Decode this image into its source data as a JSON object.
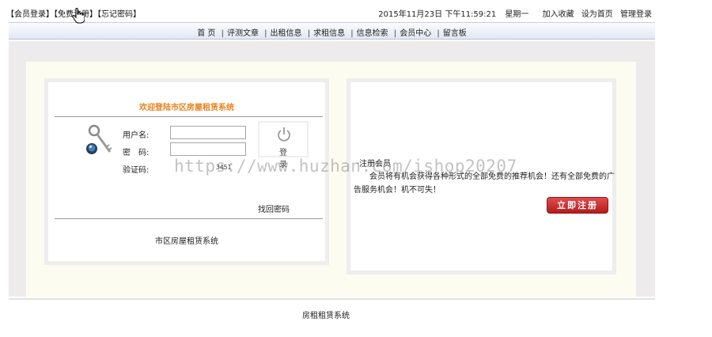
{
  "topbar": {
    "login_link": "【会员登录】",
    "register_link": "【免费注册】",
    "forgot_link": "【忘记密码】",
    "datetime": "2015年11月23日 下午11:59:21",
    "weekday": "星期一",
    "favorite_link": "加入收藏",
    "homepage_link": "设为首页",
    "admin_link": "管理登录"
  },
  "nav": {
    "items": [
      {
        "label": "首 页"
      },
      {
        "label": "评测文章"
      },
      {
        "label": "出租信息"
      },
      {
        "label": "求租信息"
      },
      {
        "label": "信息检索"
      },
      {
        "label": "会员中心"
      },
      {
        "label": "留言板"
      }
    ],
    "separator": "|"
  },
  "login": {
    "title": "欢迎登陆市区房屋租赁系统",
    "username_label": "用户名:",
    "password_label": "密　码:",
    "captcha_label": "验证码:",
    "captcha_value": "3451",
    "login_button": "登录",
    "forgot_link": "找回密码",
    "footer": "市区房屋租赁系统"
  },
  "register": {
    "heading": "·注册会员",
    "description": "会员将有机会获得各种形式的全部免费的推荐机会！还有全部免费的广告服务机会！机不可失！",
    "button": "立即注册"
  },
  "footer": {
    "text": "房租租赁系统"
  },
  "watermark": "https://www.huzhan.com/ishop20207",
  "colors": {
    "title_orange": "#e8821c",
    "button_red": "#c82a2a"
  }
}
